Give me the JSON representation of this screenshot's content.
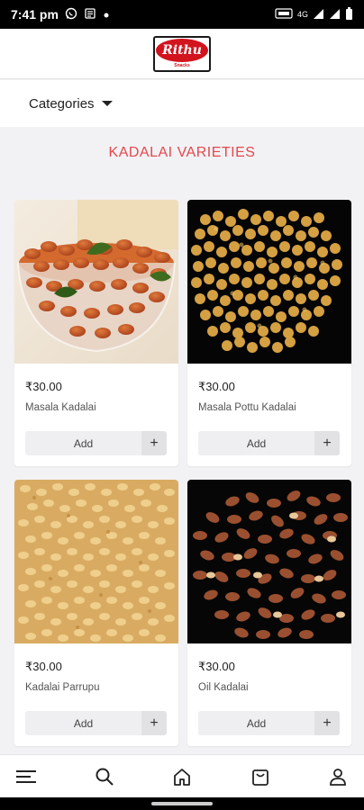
{
  "status_bar": {
    "time": "7:41 pm",
    "network": "4G"
  },
  "header": {
    "logo_text": "Rithu",
    "logo_sub": "Snacks"
  },
  "categories": {
    "label": "Categories"
  },
  "section": {
    "title": "KADALAI VARIETIES"
  },
  "products": [
    {
      "price": "₹30.00",
      "name": "Masala Kadalai",
      "add_label": "Add",
      "plus_label": "+"
    },
    {
      "price": "₹30.00",
      "name": "Masala Pottu Kadalai",
      "add_label": "Add",
      "plus_label": "+"
    },
    {
      "price": "₹30.00",
      "name": "Kadalai Parrupu",
      "add_label": "Add",
      "plus_label": "+"
    },
    {
      "price": "₹30.00",
      "name": "Oil Kadalai",
      "add_label": "Add",
      "plus_label": "+"
    }
  ],
  "bottom_nav": [
    "menu-icon",
    "search-icon",
    "home-icon",
    "cart-icon",
    "user-icon"
  ],
  "colors": {
    "accent": "#e3484e",
    "brand_red": "#d2141e",
    "background": "#f2f2f4"
  }
}
